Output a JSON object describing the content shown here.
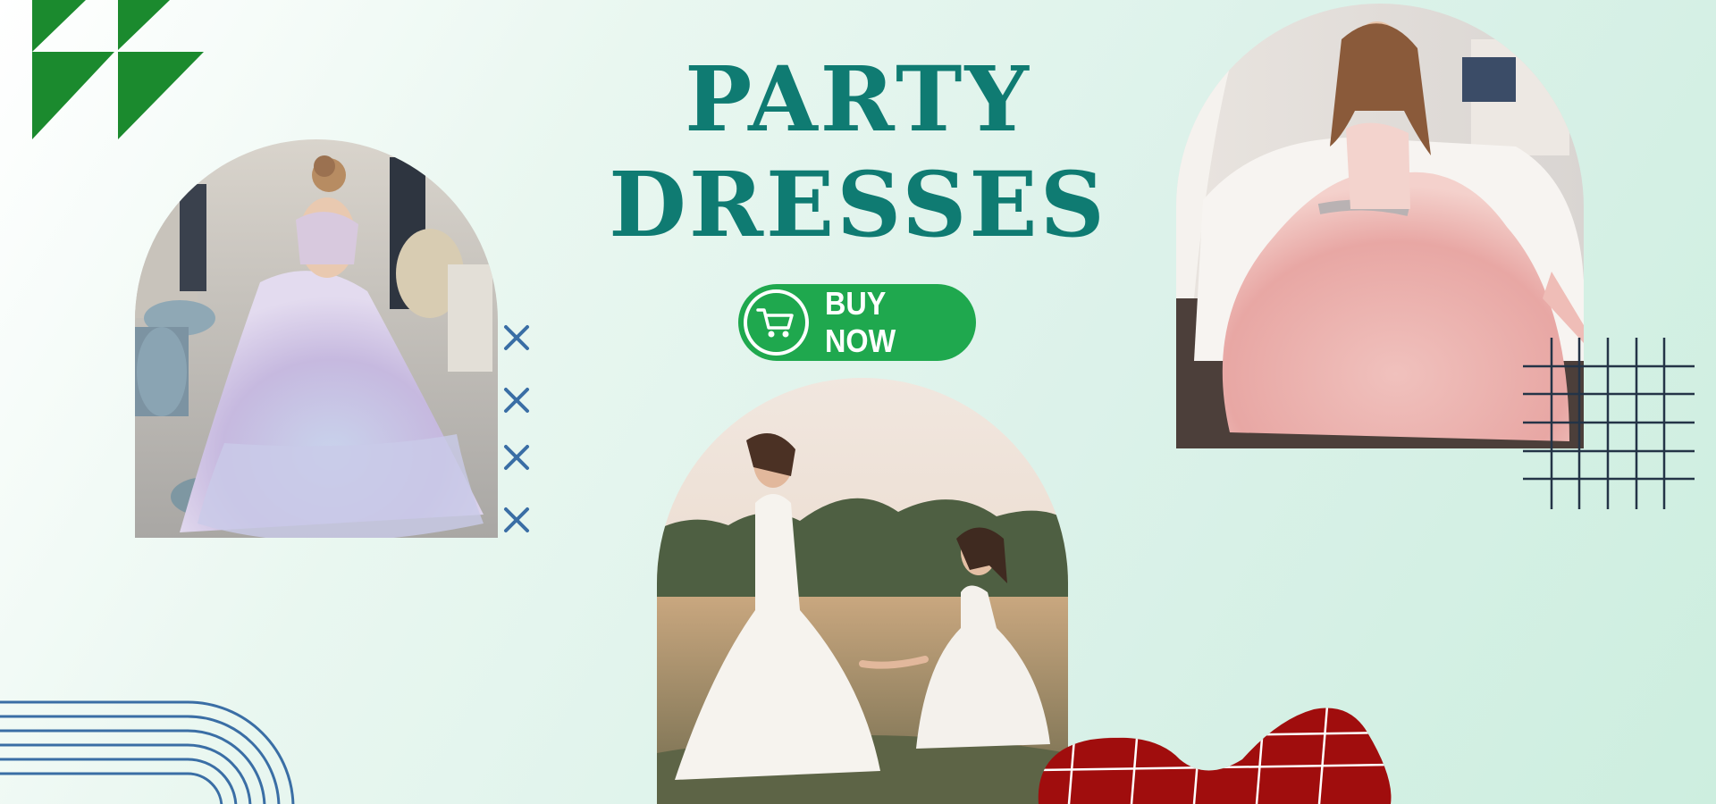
{
  "heading": {
    "line1": "PARTY",
    "line2": "DRESSES"
  },
  "cta": {
    "label": "BUY NOW",
    "icon": "shopping-cart-icon"
  },
  "photos": [
    {
      "name": "girl-lilac-ball-gown-photo"
    },
    {
      "name": "girl-pink-ruffle-gown-photo"
    },
    {
      "name": "mother-daughter-white-dresses-photo"
    }
  ],
  "colors": {
    "title": "#0f7b72",
    "button": "#1fa84e",
    "accent_green": "#1b8a2e",
    "accent_blue": "#3a6ea5",
    "accent_red": "#a00d0d",
    "grid_navy": "#243447"
  }
}
